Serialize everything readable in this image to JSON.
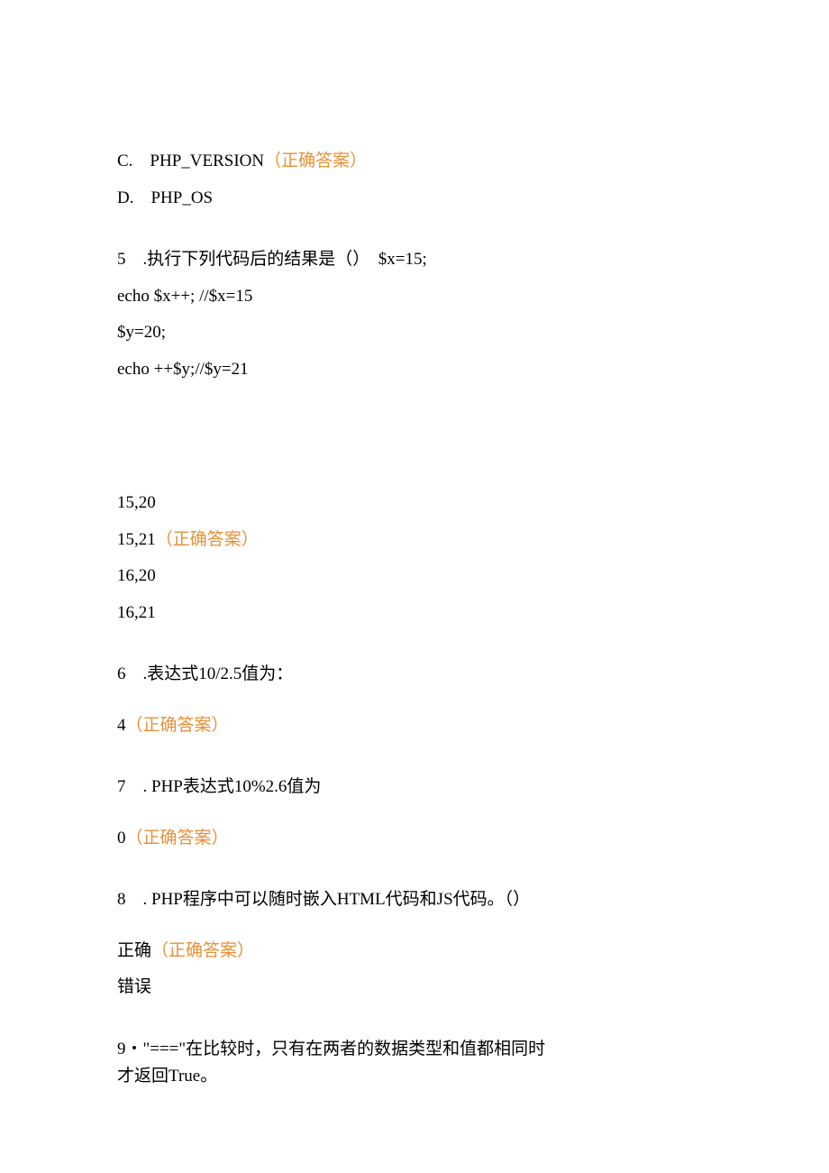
{
  "optC": {
    "label": "C.　PHP_VERSION",
    "mark": "（正确答案）"
  },
  "optD": {
    "label": "D.　PHP_OS"
  },
  "q5": {
    "head": "5　.执行下列代码后的结果是（）　$x=15;",
    "code1": "echo $x++; //$x=15",
    "code2": "$y=20;",
    "code3": "echo ++$y;//$y=21",
    "a1": "15,20",
    "a2": "15,21",
    "a2mark": "（正确答案）",
    "a3": "16,20",
    "a4": "16,21"
  },
  "q6": {
    "head": "6　.表达式10/2.5值为：",
    "ans": "4",
    "mark": "（正确答案）"
  },
  "q7": {
    "head": "7　. PHP表达式10%2.6值为",
    "ans": "0",
    "mark": "（正确答案）"
  },
  "q8": {
    "head": "8　. PHP程序中可以随时嵌入HTML代码和JS代码。（）",
    "a1": "正确",
    "a1mark": "（正确答案）",
    "a2": "错误"
  },
  "q9": {
    "l1": "9・\"===\"在比较时，只有在两者的数据类型和值都相同时",
    "l2": "才返回True。"
  }
}
